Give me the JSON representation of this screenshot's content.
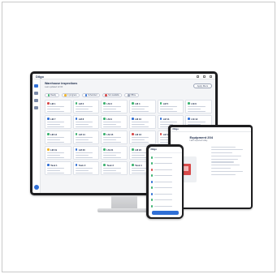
{
  "monitor": {
    "app_title": "Dilgo",
    "header_title": "Warehouse inspections",
    "header_sub": "Last updated 12:00",
    "apply_button": "Apply filters",
    "filters": [
      {
        "label": "Ready",
        "color": "#3cb371"
      },
      {
        "label": "In progress",
        "color": "#f0b429"
      },
      {
        "label": "Scheduled",
        "color": "#2f6fd6"
      },
      {
        "label": "Not available",
        "color": "#d84a4a"
      },
      {
        "label": "Offline",
        "color": "#9aa3b5"
      }
    ],
    "cards": [
      {
        "name": "LM 1",
        "color": "#d84a4a"
      },
      {
        "name": "LM 2",
        "color": "#3cb371"
      },
      {
        "name": "LM 3",
        "color": "#3cb371"
      },
      {
        "name": "LM 4",
        "color": "#3cb371"
      },
      {
        "name": "LM 5",
        "color": "#3cb371"
      },
      {
        "name": "LM 6",
        "color": "#3cb371"
      },
      {
        "name": "LM 7",
        "color": "#2f6fd6"
      },
      {
        "name": "LM 8",
        "color": "#2f6fd6"
      },
      {
        "name": "LM 9",
        "color": "#3cb371"
      },
      {
        "name": "LM 10",
        "color": "#2f6fd6"
      },
      {
        "name": "LM 11",
        "color": "#2f6fd6"
      },
      {
        "name": "LM 12",
        "color": "#2f6fd6"
      },
      {
        "name": "LM 13",
        "color": "#3cb371"
      },
      {
        "name": "LM 14",
        "color": "#3cb371"
      },
      {
        "name": "LM 15",
        "color": "#3cb371"
      },
      {
        "name": "LM 16",
        "color": "#d84a4a"
      },
      {
        "name": "LM 17",
        "color": "#d84a4a"
      },
      {
        "name": "LM 18",
        "color": "#3cb371"
      },
      {
        "name": "LM 19",
        "color": "#f0b429"
      },
      {
        "name": "LM 20",
        "color": "#2f6fd6"
      },
      {
        "name": "LM 21",
        "color": "#3cb371"
      },
      {
        "name": "LM 22",
        "color": "#3cb371"
      },
      {
        "name": "LM 23",
        "color": "#d84a4a"
      },
      {
        "name": "LM 24",
        "color": "#3cb371"
      },
      {
        "name": "Task 1",
        "color": "#2f6fd6"
      },
      {
        "name": "Task 2",
        "color": "#2f6fd6"
      },
      {
        "name": "Task 3",
        "color": "#3cb371"
      },
      {
        "name": "Task 4",
        "color": "#3cb371"
      },
      {
        "name": "Task 5",
        "color": "#2f6fd6"
      },
      {
        "name": "Task 6",
        "color": "#9aa3b5"
      }
    ]
  },
  "tablet": {
    "app_title": "Dilgo",
    "detail_title": "Equipment 204",
    "detail_sub": "Last inspected today"
  },
  "phone": {
    "app_title": "Dilgo",
    "items": [
      {
        "color": "#3cb371"
      },
      {
        "color": "#3cb371"
      },
      {
        "color": "#d84a4a"
      },
      {
        "color": "#3cb371"
      },
      {
        "color": "#2f6fd6"
      },
      {
        "color": "#3cb371"
      },
      {
        "color": "#2f6fd6"
      },
      {
        "color": "#3cb371"
      },
      {
        "color": "#3cb371"
      }
    ]
  }
}
